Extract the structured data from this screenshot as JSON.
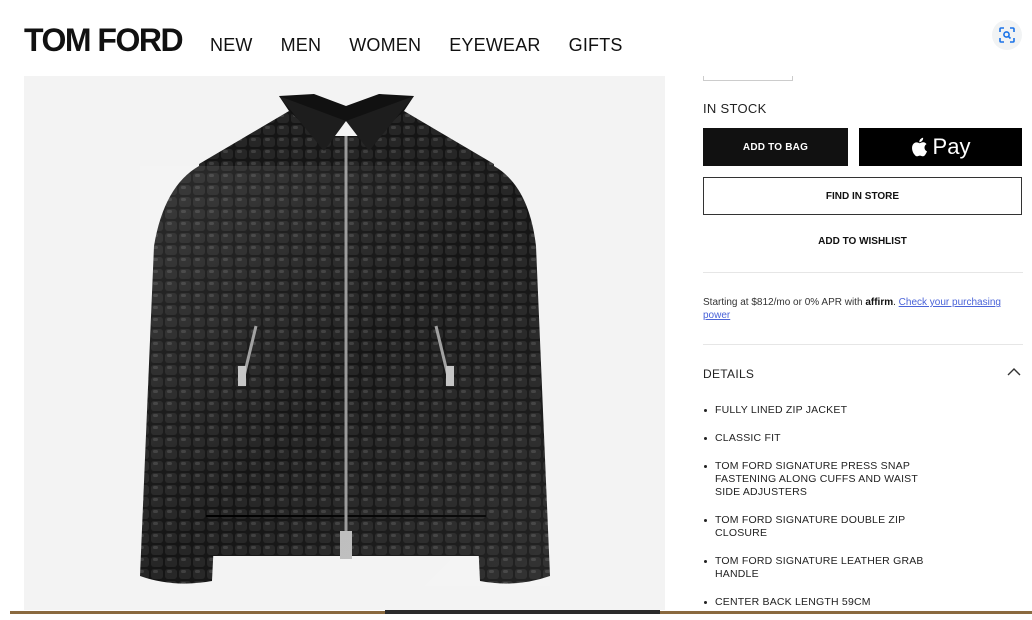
{
  "header": {
    "logo": "TOM FORD",
    "nav": [
      "NEW",
      "MEN",
      "WOMEN",
      "EYEWEAR",
      "GIFTS"
    ]
  },
  "product_image": {
    "subject": "black glossy croc-embossed leather zip jacket"
  },
  "purchase": {
    "stock_status": "IN STOCK",
    "add_to_bag": "ADD TO BAG",
    "apple_pay_label": "Pay",
    "find_in_store": "FIND IN STORE",
    "add_to_wishlist": "ADD TO WISHLIST"
  },
  "financing": {
    "text": "Starting at $812/mo or 0% APR with",
    "brand": "affirm",
    "link": "Check your purchasing power"
  },
  "details": {
    "title": "DETAILS",
    "items": [
      "FULLY LINED ZIP JACKET",
      "CLASSIC FIT",
      "TOM FORD SIGNATURE PRESS SNAP FASTENING ALONG CUFFS AND WAIST SIDE ADJUSTERS",
      "TOM FORD SIGNATURE DOUBLE ZIP CLOSURE",
      "TOM FORD SIGNATURE LEATHER GRAB HANDLE",
      "CENTER BACK LENGTH 59CM"
    ]
  },
  "icons": {
    "screenshot": "screenshot-search-icon",
    "apple": "apple-logo-icon",
    "collapse": "chevron-up-icon"
  }
}
